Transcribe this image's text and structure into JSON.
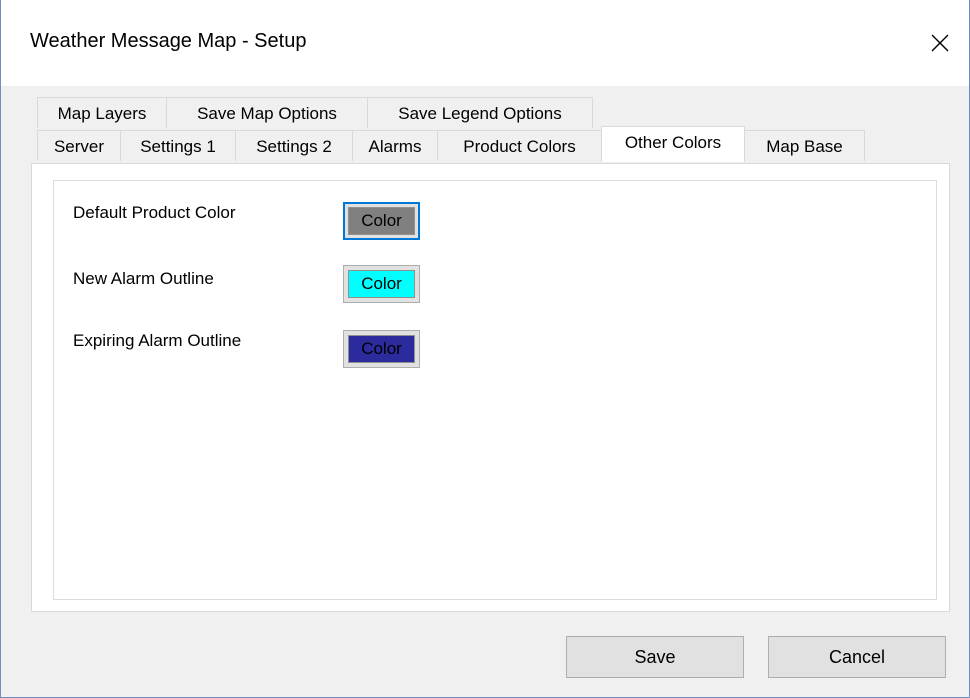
{
  "window": {
    "title": "Weather Message Map - Setup",
    "close_icon": "close-icon"
  },
  "tabs": {
    "row1": [
      "Map Layers",
      "Save Map Options",
      "Save Legend Options"
    ],
    "row2": [
      "Server",
      "Settings 1",
      "Settings 2",
      "Alarms",
      "Product Colors",
      "Other Colors",
      "Map Base"
    ],
    "active": "Other Colors"
  },
  "colors_panel": {
    "rows": [
      {
        "label": "Default Product Color",
        "button_label": "Color",
        "swatch_color": "#808080"
      },
      {
        "label": "New Alarm Outline",
        "button_label": "Color",
        "swatch_color": "#00ffff"
      },
      {
        "label": "Expiring Alarm Outline",
        "button_label": "Color",
        "swatch_color": "#2b2b9e"
      }
    ]
  },
  "buttons": {
    "save": "Save",
    "cancel": "Cancel"
  },
  "theme": {
    "focus_color": "#0078d7",
    "window_border": "#6d8fc4"
  }
}
